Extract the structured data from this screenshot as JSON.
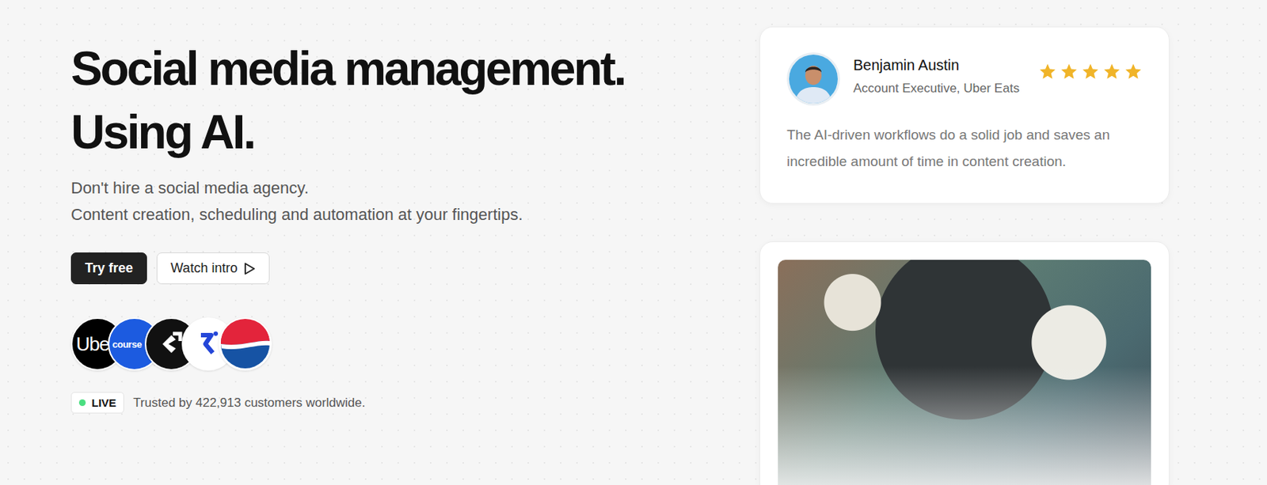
{
  "hero": {
    "title_lines": [
      "Social media management.",
      "Using AI."
    ],
    "subtitle_lines": [
      "Don't hire a social media agency.",
      "Content creation, scheduling and automation at your fingertips."
    ]
  },
  "buttons": [
    {
      "label": "Try free",
      "kind": "primary"
    },
    {
      "label": "Watch intro",
      "kind": "secondary"
    }
  ],
  "logos": [
    {
      "kind": "uber",
      "text": "Ube"
    },
    {
      "kind": "coursera",
      "text": "course"
    },
    {
      "kind": "glyph",
      "text": ""
    },
    {
      "kind": "chevron",
      "text": ""
    },
    {
      "kind": "pepsi",
      "text": ""
    }
  ],
  "status": {
    "badge": "LIVE",
    "live": true,
    "text": "Trusted by 422,913 customers worldwide."
  },
  "testimonial": {
    "name": "Benjamin Austin",
    "role": "Account Executive, Uber Eats",
    "stars": 5,
    "quote": "The AI-driven workflows do a solid job and saves an incredible amount of time in content creation."
  }
}
